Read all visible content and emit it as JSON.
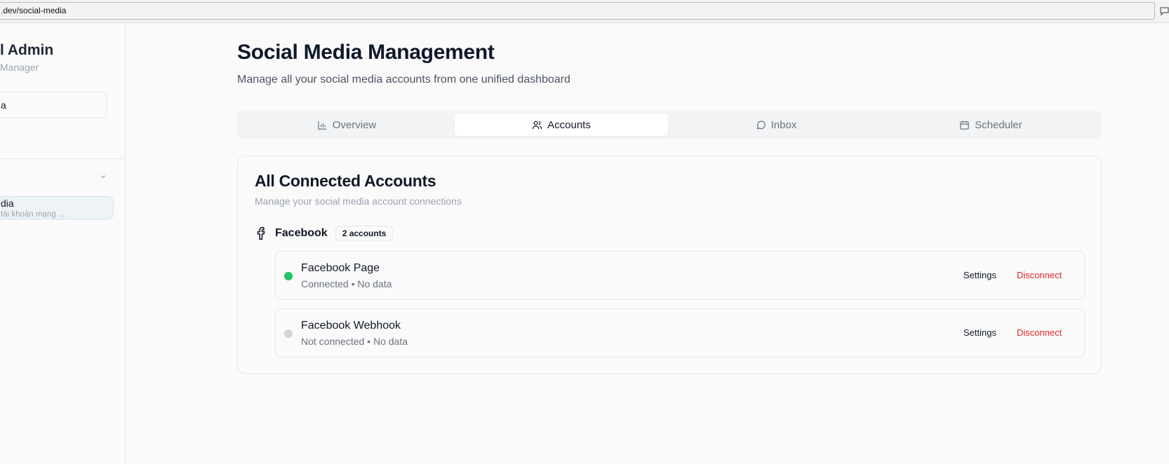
{
  "browser": {
    "url": ".dev/social-media"
  },
  "sidebar": {
    "title": "l Admin",
    "subtitle": "Manager",
    "search_value": "a",
    "nav_item": {
      "label": "dia",
      "sub": "tài khoản mạng ..."
    }
  },
  "main": {
    "title": "Social Media Management",
    "subtitle": "Manage all your social media accounts from one unified dashboard",
    "tabs": [
      {
        "label": "Overview",
        "icon": "bar-chart-icon",
        "active": false
      },
      {
        "label": "Accounts",
        "icon": "users-icon",
        "active": true
      },
      {
        "label": "Inbox",
        "icon": "message-circle-icon",
        "active": false
      },
      {
        "label": "Scheduler",
        "icon": "calendar-icon",
        "active": false
      }
    ]
  },
  "accounts_card": {
    "title": "All Connected Accounts",
    "subtitle": "Manage your social media account connections",
    "groups": [
      {
        "platform": "Facebook",
        "icon": "facebook-icon",
        "count_label": "2 accounts",
        "accounts": [
          {
            "name": "Facebook Page",
            "meta": "Connected • No data",
            "status_color": "#22c55e",
            "settings_label": "Settings",
            "disconnect_label": "Disconnect"
          },
          {
            "name": "Facebook Webhook",
            "meta": "Not connected • No data",
            "status_color": "#d1d5db",
            "settings_label": "Settings",
            "disconnect_label": "Disconnect"
          }
        ]
      }
    ]
  },
  "colors": {
    "connected": "#22c55e",
    "disconnected": "#d1d5db",
    "danger": "#dc2626"
  }
}
